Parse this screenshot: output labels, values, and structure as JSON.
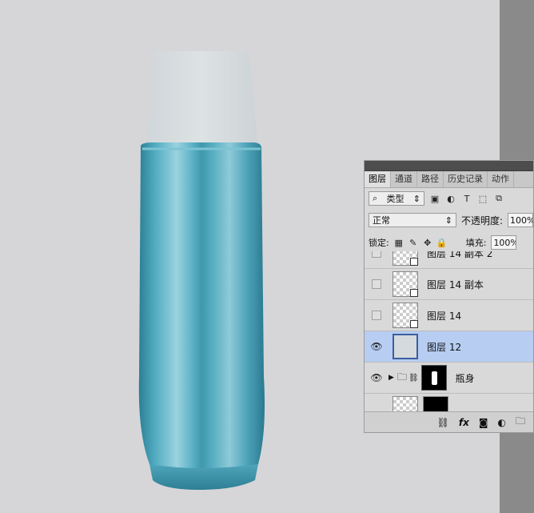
{
  "panel": {
    "tabs": [
      "图层",
      "通道",
      "路径",
      "历史记录",
      "动作"
    ],
    "filter": {
      "label": "类型",
      "icons": [
        "image-icon",
        "adjustment-icon",
        "T",
        "shape-icon",
        "smartobject-icon"
      ]
    },
    "blend": {
      "mode": "正常",
      "opacity_label": "不透明度:",
      "opacity_value": "100%"
    },
    "lock": {
      "label": "锁定:",
      "fill_label": "填充:",
      "fill_value": "100%"
    },
    "layers": [
      {
        "name": "图层 14 副本 2",
        "visible": false,
        "type": "smart"
      },
      {
        "name": "图层 14 副本",
        "visible": false,
        "type": "smart"
      },
      {
        "name": "图层 14",
        "visible": false,
        "type": "smart"
      },
      {
        "name": "图层 12",
        "visible": true,
        "type": "pixel",
        "selected": true
      },
      {
        "name": "瓶身",
        "visible": true,
        "type": "group"
      }
    ],
    "bottom_icons": [
      "link-icon",
      "fx",
      "mask-icon",
      "adjustment-layer-icon",
      "folder-icon"
    ]
  },
  "colors": {
    "bottle": "#3a9cb4",
    "cap": "#d4dadd",
    "selected_layer": "#b7cdf2",
    "canvas": "#d6d6d8"
  }
}
